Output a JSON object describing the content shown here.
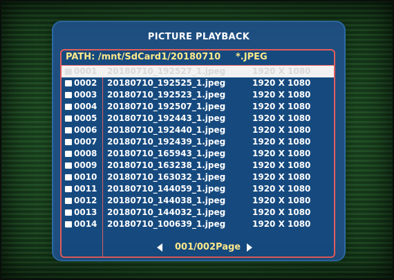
{
  "title": "PICTURE PLAYBACK",
  "path_label": "PATH: /mnt/SdCard1/20180710",
  "file_type": "*.JPEG",
  "files": [
    {
      "index": "0001",
      "name": "20180710_192527_1.jpeg",
      "resolution": "1920 X 1080",
      "selected": true
    },
    {
      "index": "0002",
      "name": "20180710_192525_1.jpeg",
      "resolution": "1920 X 1080"
    },
    {
      "index": "0003",
      "name": "20180710_192523_1.jpeg",
      "resolution": "1920 X 1080"
    },
    {
      "index": "0004",
      "name": "20180710_192507_1.jpeg",
      "resolution": "1920 X 1080"
    },
    {
      "index": "0005",
      "name": "20180710_192443_1.jpeg",
      "resolution": "1920 X 1080"
    },
    {
      "index": "0006",
      "name": "20180710_192440_1.jpeg",
      "resolution": "1920 X 1080"
    },
    {
      "index": "0007",
      "name": "20180710_192439_1.jpeg",
      "resolution": "1920 X 1080"
    },
    {
      "index": "0008",
      "name": "20180710_165943_1.jpeg",
      "resolution": "1920 X 1080"
    },
    {
      "index": "0009",
      "name": "20180710_163238_1.jpeg",
      "resolution": "1920 X 1080"
    },
    {
      "index": "0010",
      "name": "20180710_163032_1.jpeg",
      "resolution": "1920 X 1080"
    },
    {
      "index": "0011",
      "name": "20180710_144059_1.jpeg",
      "resolution": "1920 X 1080"
    },
    {
      "index": "0012",
      "name": "20180710_144038_1.jpeg",
      "resolution": "1920 X 1080"
    },
    {
      "index": "0013",
      "name": "20180710_144032_1.jpeg",
      "resolution": "1920 X 1080"
    },
    {
      "index": "0014",
      "name": "20180710_100639_1.jpeg",
      "resolution": "1920 X 1080"
    }
  ],
  "pager": {
    "label": "001/002Page",
    "prev_icon": "triangle-left-icon",
    "next_icon": "triangle-right-icon"
  },
  "colors": {
    "panel_bg": "#1f4f80",
    "border_accent": "#e45d5a",
    "highlight_text": "#ffe98a",
    "selected_row_bg": "#f2f2f2"
  }
}
